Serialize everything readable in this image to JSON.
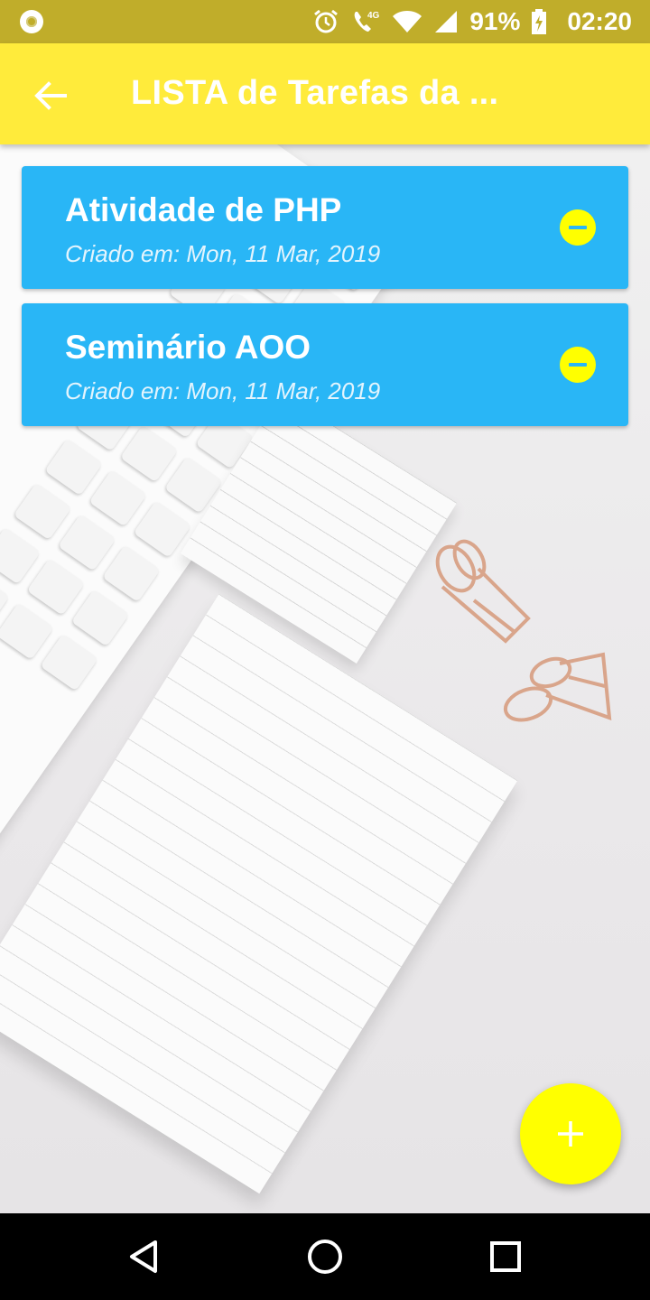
{
  "status_bar": {
    "battery": "91%",
    "time": "02:20",
    "network": "4G",
    "icons": [
      "notification-dot-icon",
      "alarm-icon",
      "call-4g-icon",
      "wifi-icon",
      "signal-icon",
      "battery-charging-icon"
    ]
  },
  "app_bar": {
    "title": "LISTA de Tarefas da ...",
    "back_icon": "arrow-back-icon",
    "background": "#ffeb3b"
  },
  "tasks": [
    {
      "title": "Atividade de PHP",
      "date": "Criado em: Mon, 11 Mar, 2019"
    },
    {
      "title": "Seminário AOO",
      "date": "Criado em: Mon, 11 Mar, 2019"
    }
  ],
  "card_color": "#29b6f6",
  "remove_icon": "remove-circle-icon",
  "fab": {
    "icon": "plus-icon",
    "color": "#ffff00"
  },
  "nav_bar": {
    "buttons": [
      "back-triangle-icon",
      "home-circle-icon",
      "recents-square-icon"
    ]
  }
}
